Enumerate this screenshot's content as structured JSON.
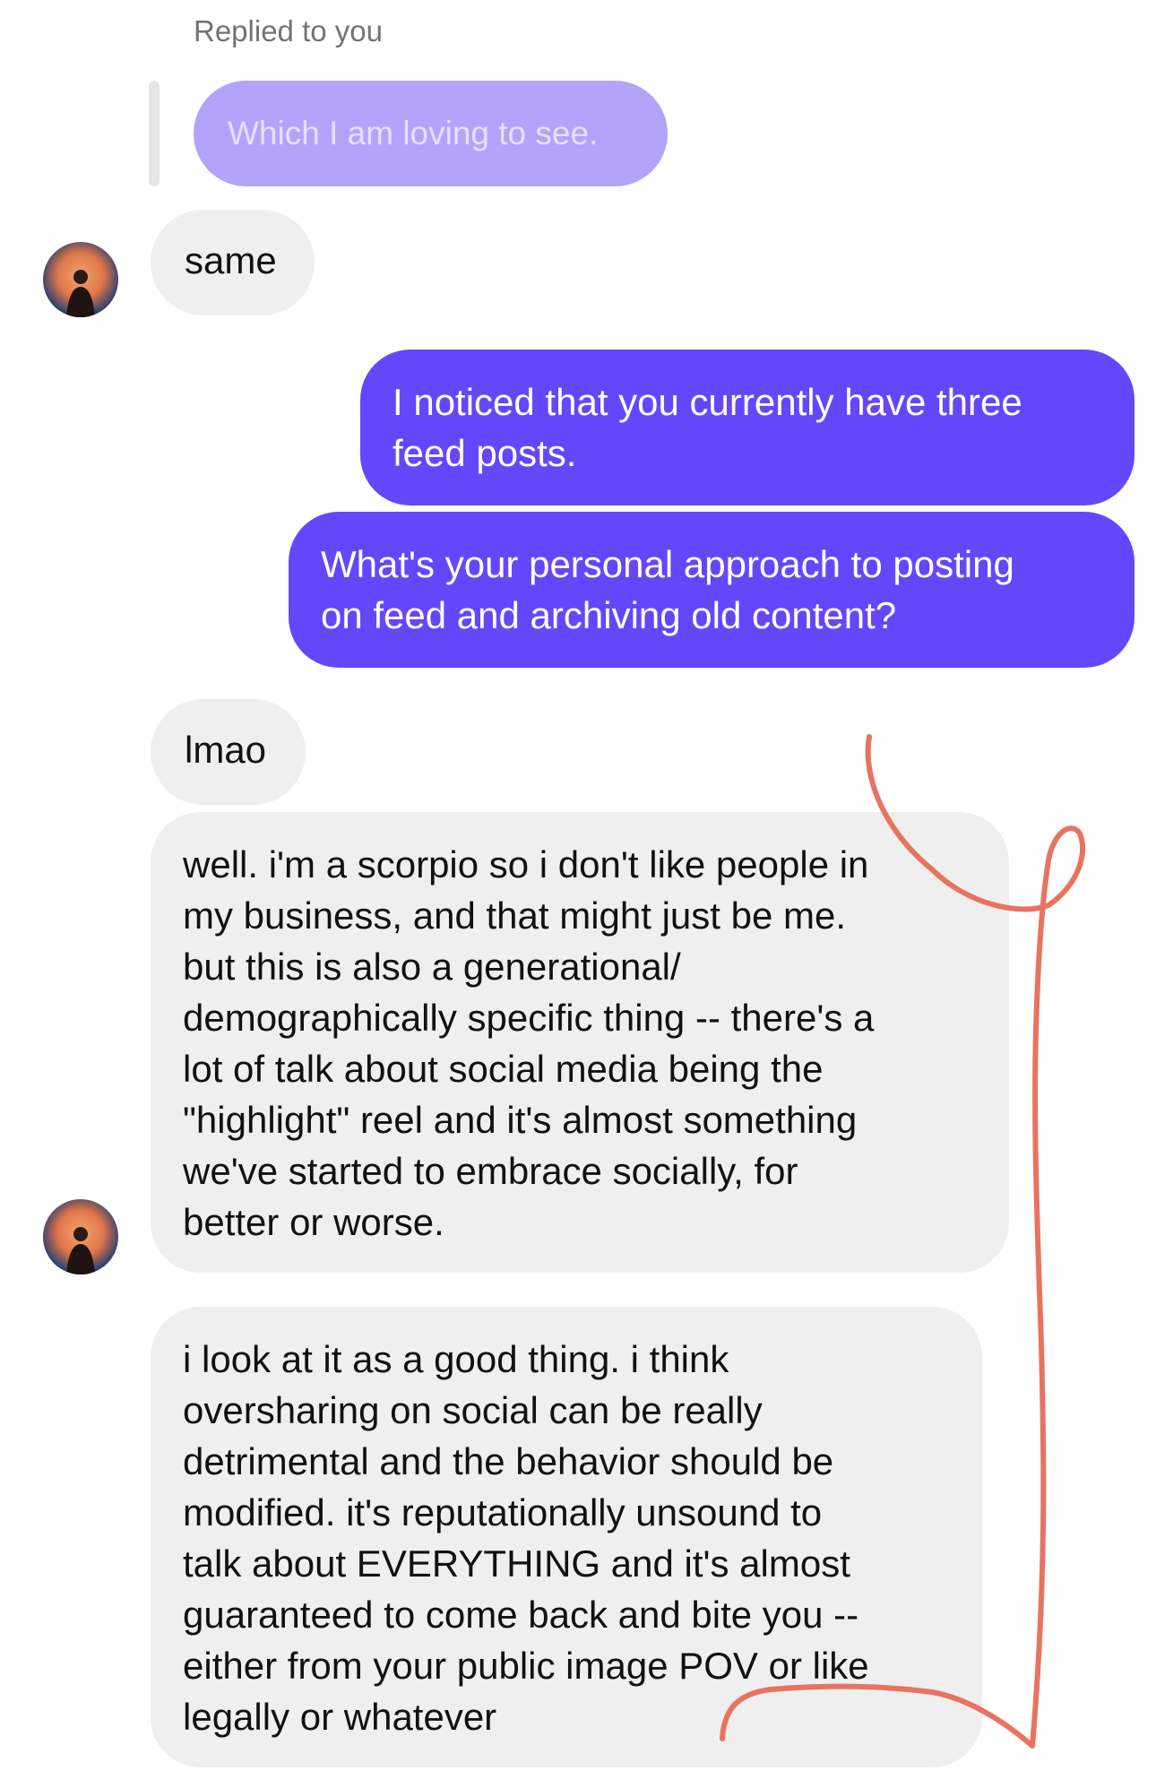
{
  "reply_header": {
    "label": "Replied to you",
    "quoted_message": "Which I am loving to see."
  },
  "messages": [
    {
      "sender": "them",
      "text": "same"
    },
    {
      "sender": "me",
      "text": "I noticed that you currently have three\nfeed posts."
    },
    {
      "sender": "me",
      "text": "What's your personal approach to posting\non feed and archiving old content?"
    },
    {
      "sender": "them",
      "text": "lmao"
    },
    {
      "sender": "them",
      "text": "well. i'm a scorpio so i don't like people in\nmy business, and that might just be me.\nbut this is also a generational/\ndemographically specific thing -- there's a\nlot of talk about social media being the\n\"highlight\" reel and it's almost something\nwe've started to embrace socially, for\nbetter or worse."
    },
    {
      "sender": "them",
      "text": "i look at it as a good thing. i think\noversharing on social can be really\ndetrimental and the behavior should be\nmodified. it's reputationally unsound to\ntalk about EVERYTHING and it's almost\nguaranteed to come back and bite you --\neither from your public image POV or like\nlegally or whatever"
    }
  ],
  "colors": {
    "incoming_bubble": "#efefef",
    "outgoing_bubble": "#6547fb",
    "quoted_bubble": "#b3a3fb",
    "annotation_stroke": "#e8735f"
  },
  "icons": {
    "avatar": "profile-photo-avatar"
  }
}
